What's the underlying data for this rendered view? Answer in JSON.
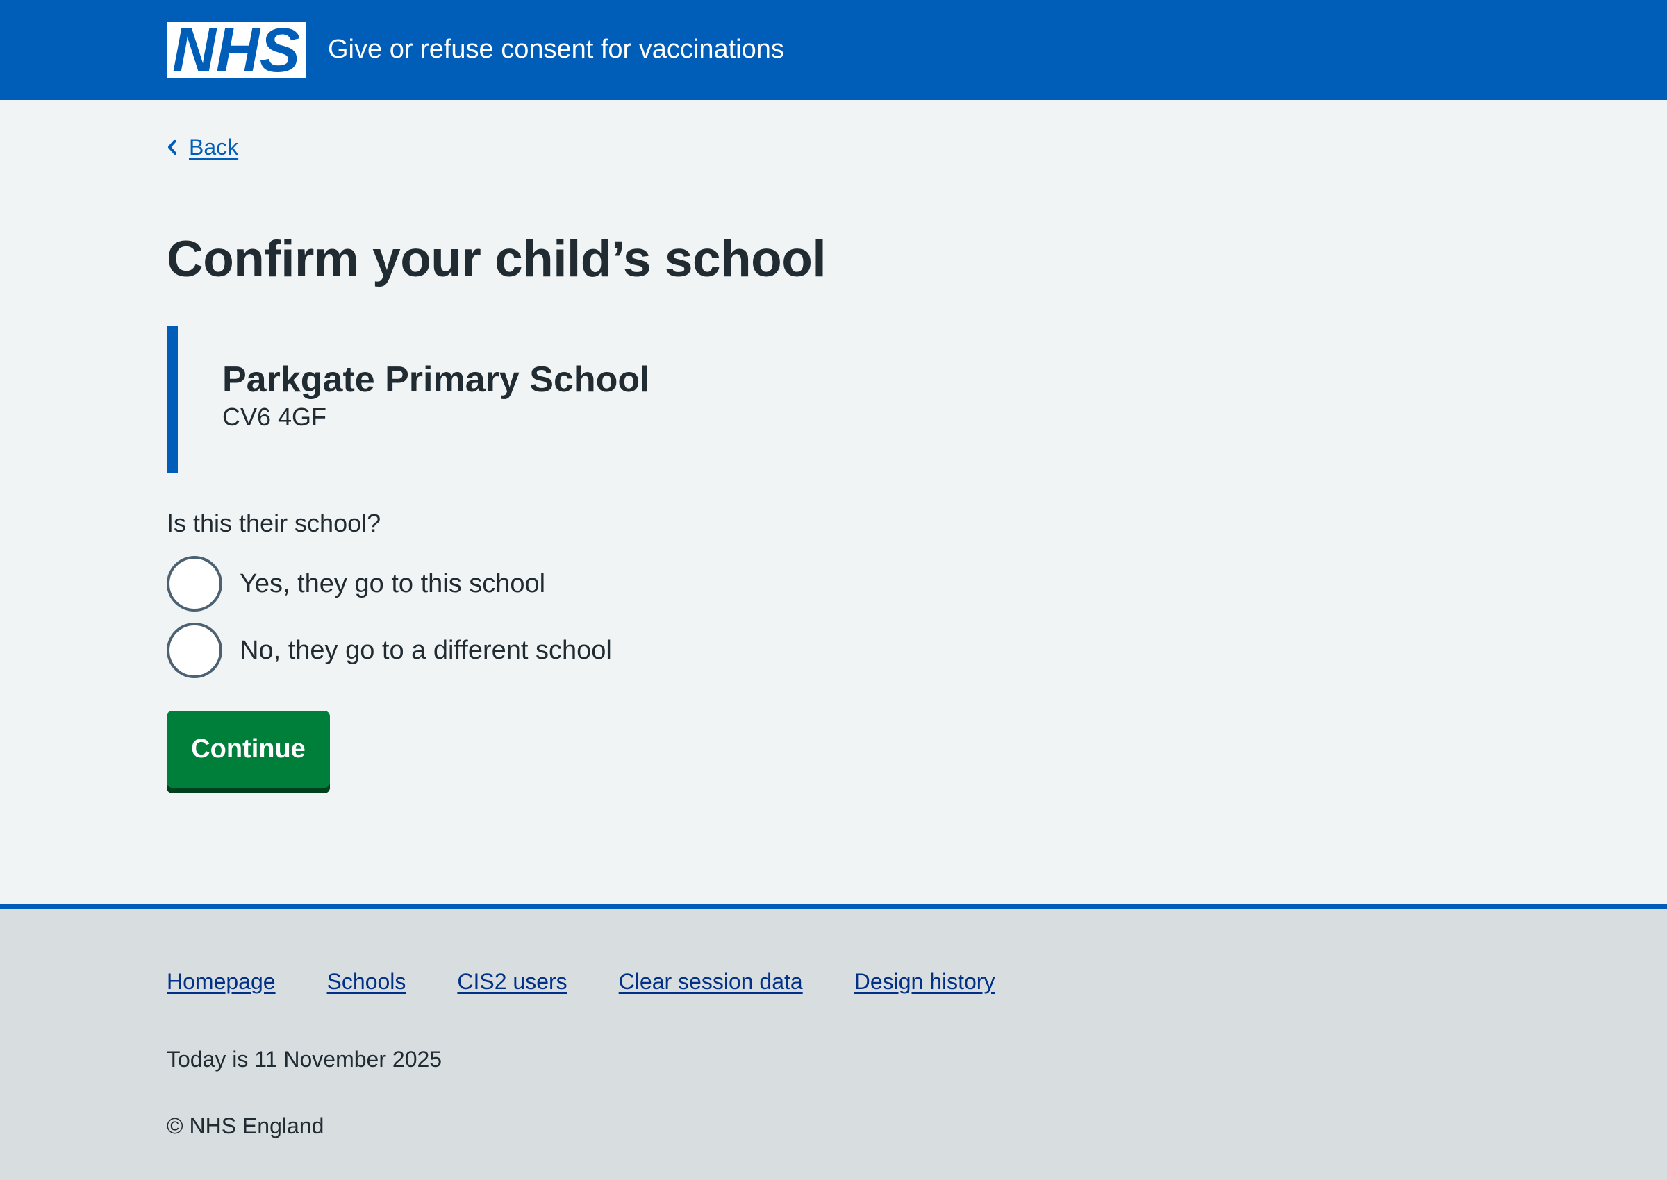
{
  "header": {
    "logo_text": "NHS",
    "service_name": "Give or refuse consent for vaccinations"
  },
  "colors": {
    "nhs_blue": "#005eb8",
    "button_green": "#007f3b",
    "link_dark_blue": "#003087",
    "page_background": "#f0f4f5",
    "footer_background": "#d8dde0"
  },
  "main": {
    "back_label": "Back",
    "title": "Confirm your child’s school",
    "school": {
      "name": "Parkgate Primary School",
      "postcode": "CV6 4GF"
    },
    "question": "Is this their school?",
    "options": [
      {
        "label": "Yes, they go to this school"
      },
      {
        "label": "No, they go to a different school"
      }
    ],
    "continue_label": "Continue"
  },
  "footer": {
    "links": [
      "Homepage",
      "Schools",
      "CIS2 users",
      "Clear session data",
      "Design history"
    ],
    "date_text": "Today is 11 November 2025",
    "copyright": "© NHS England"
  }
}
